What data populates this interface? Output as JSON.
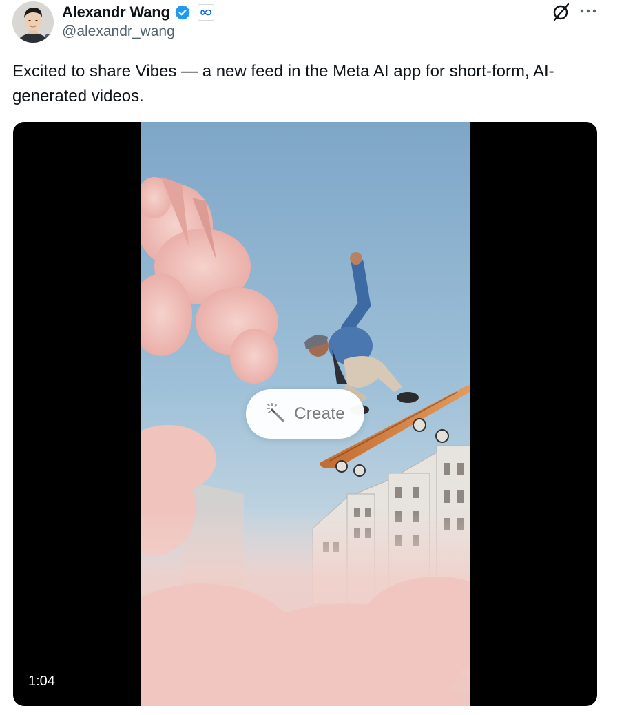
{
  "author": {
    "display_name": "Alexandr Wang",
    "handle": "@alexandr_wang",
    "verified": true,
    "affiliation_badge": "meta-infinity-icon"
  },
  "header_actions": {
    "grok_icon": "grok-icon",
    "more_icon": "more-horizontal-icon"
  },
  "tweet": {
    "text": "Excited to share Vibes — a new feed in the Meta AI app for short-form, AI-generated videos."
  },
  "media": {
    "create_label": "Create",
    "create_icon": "magic-wand-icon",
    "duration": "1:04"
  },
  "colors": {
    "verified_blue": "#1d9bf0",
    "meta_blue": "#0668e1",
    "text_primary": "#0f1419",
    "text_secondary": "#536471"
  }
}
